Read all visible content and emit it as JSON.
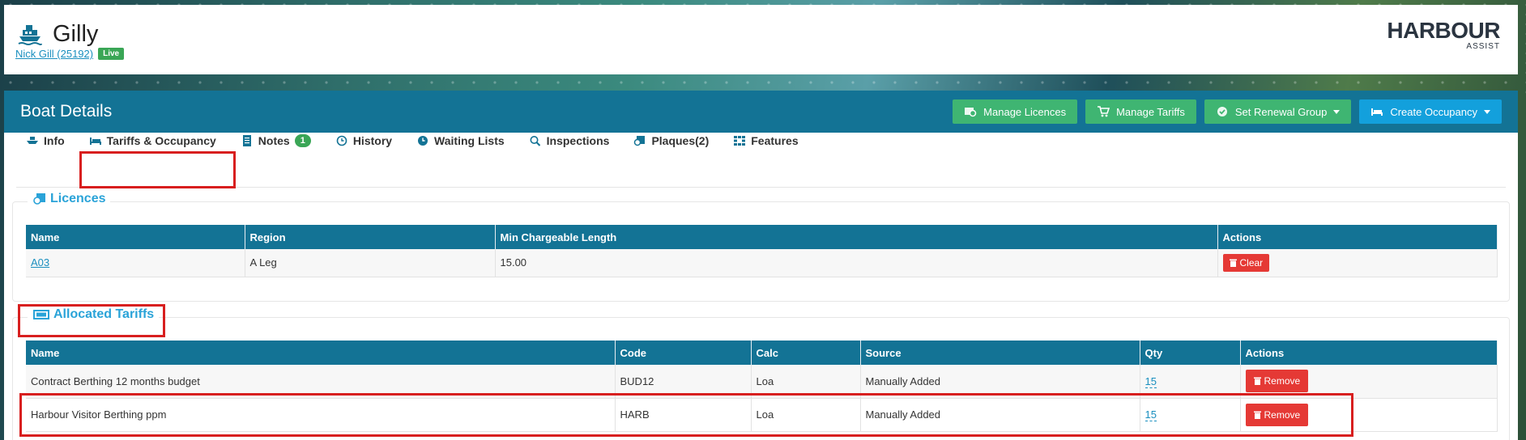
{
  "header": {
    "boat_name": "Gilly",
    "owner_link": "Nick Gill (25192)",
    "status_badge": "Live",
    "brand_main": "HARBOUR",
    "brand_sub": "ASSIST"
  },
  "panel": {
    "title": "Boat Details",
    "buttons": [
      {
        "label": "Manage Licences",
        "icon": "licence-icon",
        "color": "#3fb572"
      },
      {
        "label": "Manage Tariffs",
        "icon": "cart-icon",
        "color": "#3fb572"
      },
      {
        "label": "Set Renewal Group",
        "icon": "check-circle-icon",
        "color": "#3fb572",
        "dropdown": true
      },
      {
        "label": "Create Occupancy",
        "icon": "bed-icon",
        "color": "#13a0dc",
        "dropdown": true
      }
    ]
  },
  "tabs": [
    {
      "label": "Info",
      "icon": "boat-icon"
    },
    {
      "label": "Tariffs & Occupancy",
      "icon": "bed-icon",
      "active": true
    },
    {
      "label": "Notes",
      "icon": "document-icon",
      "badge": "1"
    },
    {
      "label": "History",
      "icon": "history-icon"
    },
    {
      "label": "Waiting Lists",
      "icon": "clock-icon"
    },
    {
      "label": "Inspections",
      "icon": "search-icon"
    },
    {
      "label": "Plaques(2)",
      "icon": "plaque-icon"
    },
    {
      "label": "Features",
      "icon": "grid-icon"
    }
  ],
  "licences": {
    "legend": "Licences",
    "columns": [
      "Name",
      "Region",
      "Min Chargeable Length",
      "Actions"
    ],
    "rows": [
      {
        "name": "A03",
        "region": "A Leg",
        "min_length": "15.00",
        "action": "Clear"
      }
    ]
  },
  "tariffs": {
    "legend": "Allocated Tariffs",
    "columns": [
      "Name",
      "Code",
      "Calc",
      "Source",
      "Qty",
      "Actions"
    ],
    "rows": [
      {
        "name": "Contract Berthing 12 months budget",
        "code": "BUD12",
        "calc": "Loa",
        "source": "Manually Added",
        "qty": "15",
        "action": "Remove"
      },
      {
        "name": "Harbour Visitor Berthing ppm",
        "code": "HARB",
        "calc": "Loa",
        "source": "Manually Added",
        "qty": "15",
        "action": "Remove"
      }
    ]
  },
  "colors": {
    "header_blue": "#137395",
    "accent_green": "#3fb572",
    "accent_blue": "#13a0dc",
    "danger_red": "#e53935",
    "highlight_red": "#d81f1f"
  }
}
